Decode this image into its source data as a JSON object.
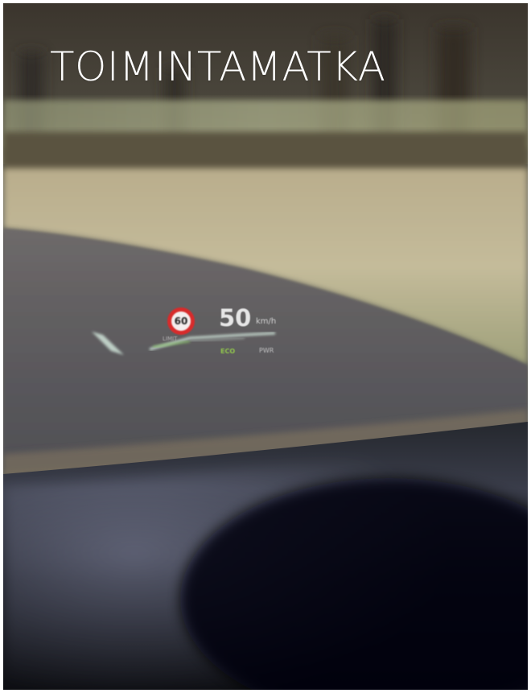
{
  "header": {
    "title": "TOIMINTAMATKA"
  },
  "hud": {
    "speed": "50",
    "speed_unit": "km/h",
    "speed_limit": "60",
    "limit_label": "LIMIT",
    "eco_label": "ECO",
    "power_label": "PWR"
  },
  "colors": {
    "title_text": "#ffffff",
    "limit_sign_border": "#d82b2b",
    "eco_indicator": "#9ad84a"
  }
}
